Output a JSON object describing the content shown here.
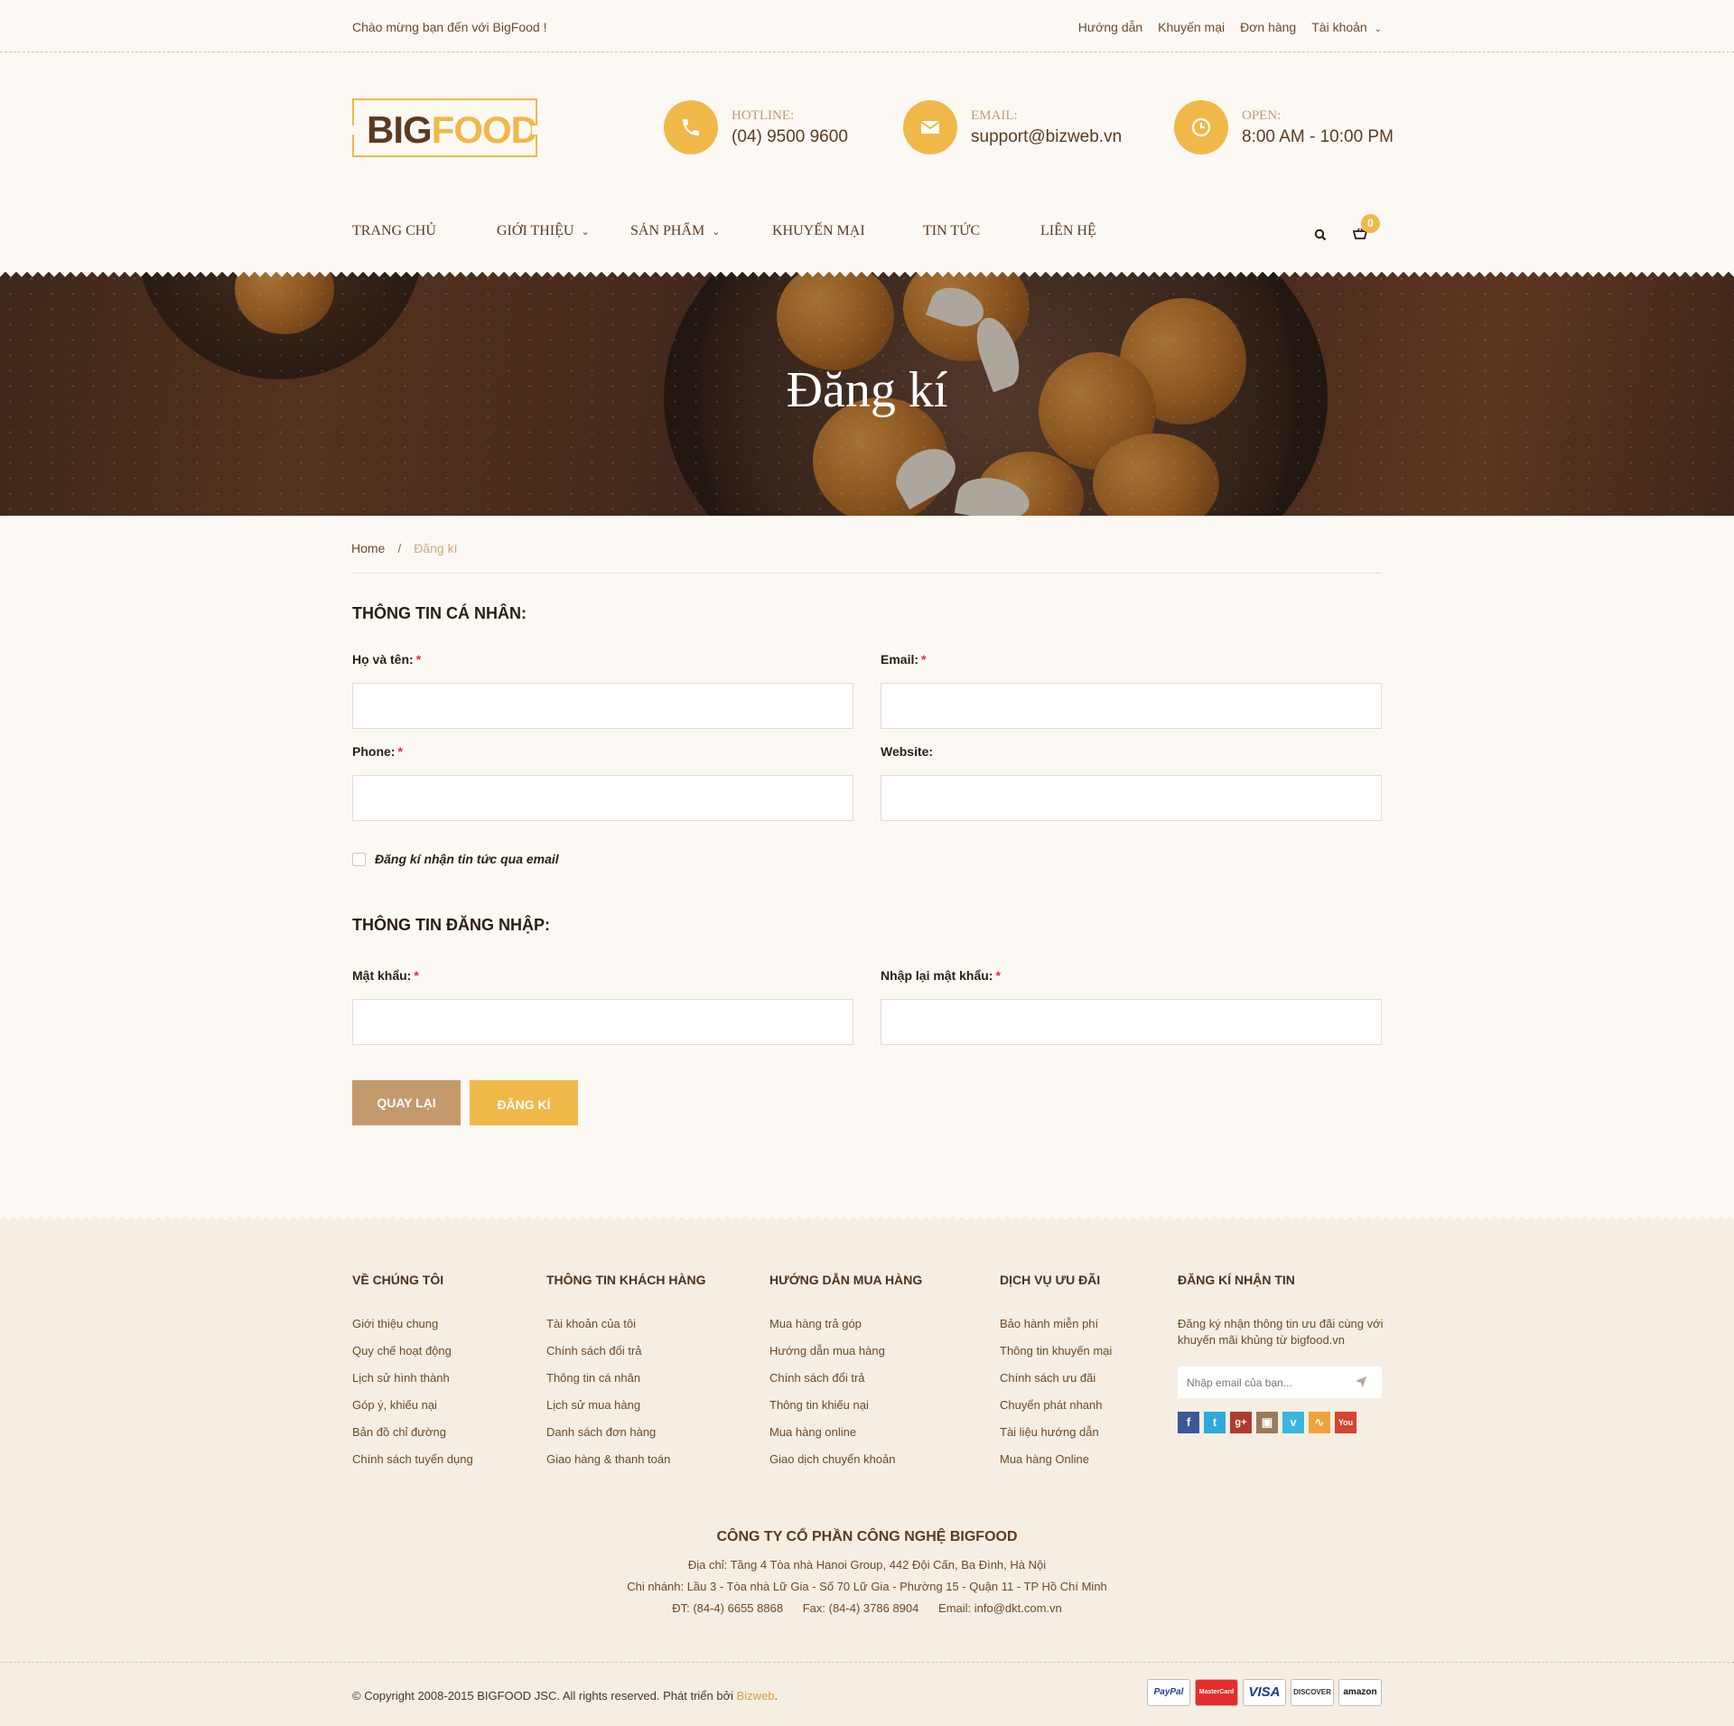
{
  "topbar": {
    "welcome": "Chào mừng bạn đến với BigFood !",
    "links": [
      "Hướng dẫn",
      "Khuyến mại",
      "Đơn hàng",
      "Tài khoản"
    ]
  },
  "logo": {
    "big": "BIG",
    "food": "FOOD"
  },
  "contact": {
    "hotline": {
      "label": "HOTLINE:",
      "value": "(04) 9500 9600",
      "icon": "phone-icon"
    },
    "email": {
      "label": "EMAIL:",
      "value": "support@bizweb.vn",
      "icon": "envelope-icon"
    },
    "open": {
      "label": "OPEN:",
      "value": "8:00 AM - 10:00 PM",
      "icon": "clock-icon"
    }
  },
  "nav": {
    "items": [
      "TRANG CHỦ",
      "GIỚI THIỆU",
      "SẢN PHẨM",
      "KHUYẾN MẠI",
      "TIN TỨC",
      "LIÊN HỆ"
    ],
    "cart_count": "0"
  },
  "hero": {
    "title": "Đăng kí"
  },
  "breadcrumb": {
    "home": "Home",
    "sep": "/",
    "current": "Đăng kí"
  },
  "form": {
    "personal_title": "THÔNG TIN CÁ NHÂN:",
    "name_label": "Họ và tên:",
    "email_label": "Email:",
    "phone_label": "Phone:",
    "website_label": "Website:",
    "required_mark": "*",
    "newsletter_label": "Đăng kí nhận tin tức qua email",
    "login_title": "THÔNG TIN ĐĂNG NHẬP:",
    "password_label": "Mật khẩu:",
    "confirm_label": "Nhập lại mật khẩu:",
    "back_button": "QUAY LẠI",
    "register_button": "ĐĂNG KÍ"
  },
  "footer": {
    "cols": [
      {
        "title": "VỀ CHÚNG TÔI",
        "items": [
          "Giới thiệu chung",
          "Quy chế hoạt động",
          "Lịch sử hình thành",
          "Góp ý,  khiếu nại",
          "Bản đồ chỉ đường",
          "Chính sách tuyển dụng"
        ]
      },
      {
        "title": "THÔNG TIN KHÁCH HÀNG",
        "items": [
          "Tài khoản của tôi",
          "Chính sách đổi trả",
          "Thông tin cá nhân",
          "Lịch sử mua hàng",
          "Danh sách đơn hàng",
          "Giao hàng & thanh toán"
        ]
      },
      {
        "title": "HƯỚNG DẪN MUA HÀNG",
        "items": [
          "Mua hàng trả góp",
          "Hướng dẫn mua hàng",
          "Chính sách đổi trả",
          "Thông tin khiếu nại",
          "Mua hàng online",
          "Giao dịch chuyển khoản"
        ]
      },
      {
        "title": "DỊCH VỤ ƯU ĐÃI",
        "items": [
          "Bảo hành miễn phí",
          "Thông tin khuyến mại",
          "Chính sách ưu đãi",
          "Chuyển phát nhanh",
          "Tài liệu hướng dẫn",
          "Mua hàng Online"
        ]
      }
    ],
    "newsletter": {
      "title": "ĐĂNG KÍ NHẬN TIN",
      "note": "Đăng ký nhận thông tin ưu đãi cùng với khuyến mãi khủng từ bigfood.vn",
      "placeholder": "Nhập email của bạn..."
    },
    "social": [
      "facebook-icon",
      "twitter-icon",
      "google-plus-icon",
      "instagram-icon",
      "vimeo-icon",
      "rss-icon",
      "youtube-icon"
    ],
    "company": {
      "name": "CÔNG TY CỔ PHẦN CÔNG NGHỆ BIGFOOD",
      "address": "Địa chỉ: Tầng 4 Tòa nhà Hanoi Group, 442 Đội Cấn, Ba Đình, Hà Nội",
      "branch": "Chi nhánh: Lầu 3 - Tòa nhà Lữ Gia - Số 70 Lữ Gia - Phường 15 - Quận 11 - TP Hồ Chí Minh",
      "contacts": "ĐT: (84-4) 6655 8868      Fax: (84-4) 3786 8904      Email: info@dkt.com.vn"
    },
    "copyright": "© Copyright 2008-2015 BIGFOOD JSC. All rights reserved. Phát triển bởi ",
    "bizweb": "Bizweb",
    "copyright_end": ".",
    "payments": [
      "PayPal",
      "MasterCard",
      "VISA",
      "DISCOVER",
      "amazon"
    ]
  }
}
